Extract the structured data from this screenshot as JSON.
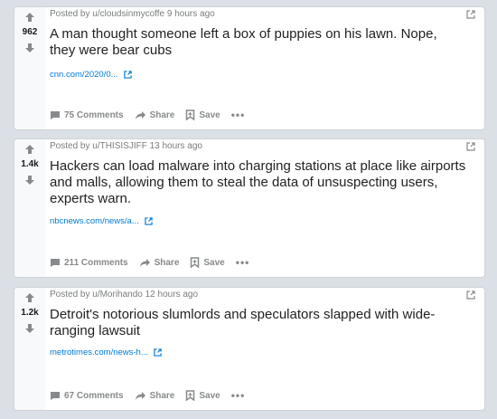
{
  "posts": [
    {
      "score": "962",
      "posted_by": "Posted by u/cloudsinmycoffe 9 hours ago",
      "title": "A man thought someone left a box of puppies on his lawn. Nope, they were bear cubs",
      "link": "cnn.com/2020/0...",
      "comments": "75 Comments",
      "share": "Share",
      "save": "Save",
      "more": "•••"
    },
    {
      "score": "1.4k",
      "posted_by": "Posted by u/THISISJIFF 13 hours ago",
      "title": "Hackers can load malware into charging stations at place like airports and malls, allowing them to steal the data of unsuspecting users, experts warn.",
      "link": "nbcnews.com/news/a...",
      "comments": "211 Comments",
      "share": "Share",
      "save": "Save",
      "more": "•••"
    },
    {
      "score": "1.2k",
      "posted_by": "Posted by u/Morihando 12 hours ago",
      "title": "Detroit's notorious slumlords and speculators slapped with wide-ranging lawsuit",
      "link": "metrotimes.com/news-h...",
      "comments": "67 Comments",
      "share": "Share",
      "save": "Save",
      "more": "•••"
    }
  ],
  "colors": {
    "background": "#dae0e6",
    "link": "#0079d3",
    "muted": "#878a8c"
  },
  "icons": [
    "upvote-icon",
    "downvote-icon",
    "external-link-icon",
    "comment-icon",
    "share-icon",
    "save-icon",
    "more-icon"
  ]
}
